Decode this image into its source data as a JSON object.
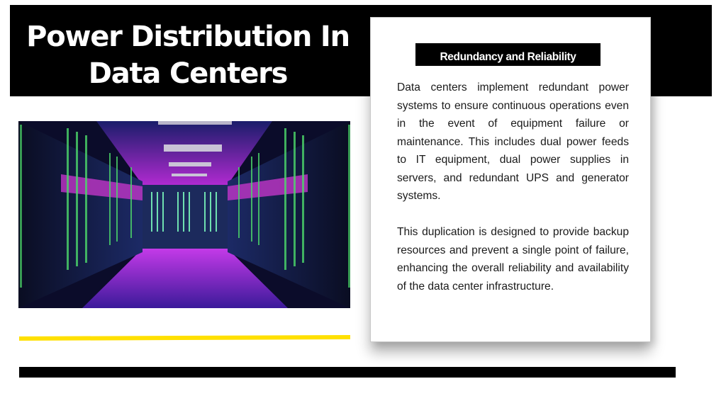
{
  "slide": {
    "title_lines": [
      "Power Distribution In",
      "Data Centers"
    ],
    "image": {
      "description": "Data center server room corridor with glowing server racks under purple and blue lighting",
      "icon": "server-room-photo"
    },
    "colors": {
      "banner": "#000000",
      "accent_line": "#ffe000",
      "bottom_bar": "#000000",
      "card_background": "#ffffff",
      "heading_background": "#000000"
    }
  },
  "card": {
    "heading": "Redundancy and Reliability",
    "paragraphs": [
      "Data centers implement redundant power systems to ensure continuous operations even in the event of equipment failure or maintenance. This includes dual power feeds to IT equipment, dual power supplies in servers, and redundant UPS and generator systems.",
      "This duplication is designed to provide backup resources and prevent a single point of failure, enhancing the overall reliability and availability of the data center infrastructure."
    ]
  }
}
